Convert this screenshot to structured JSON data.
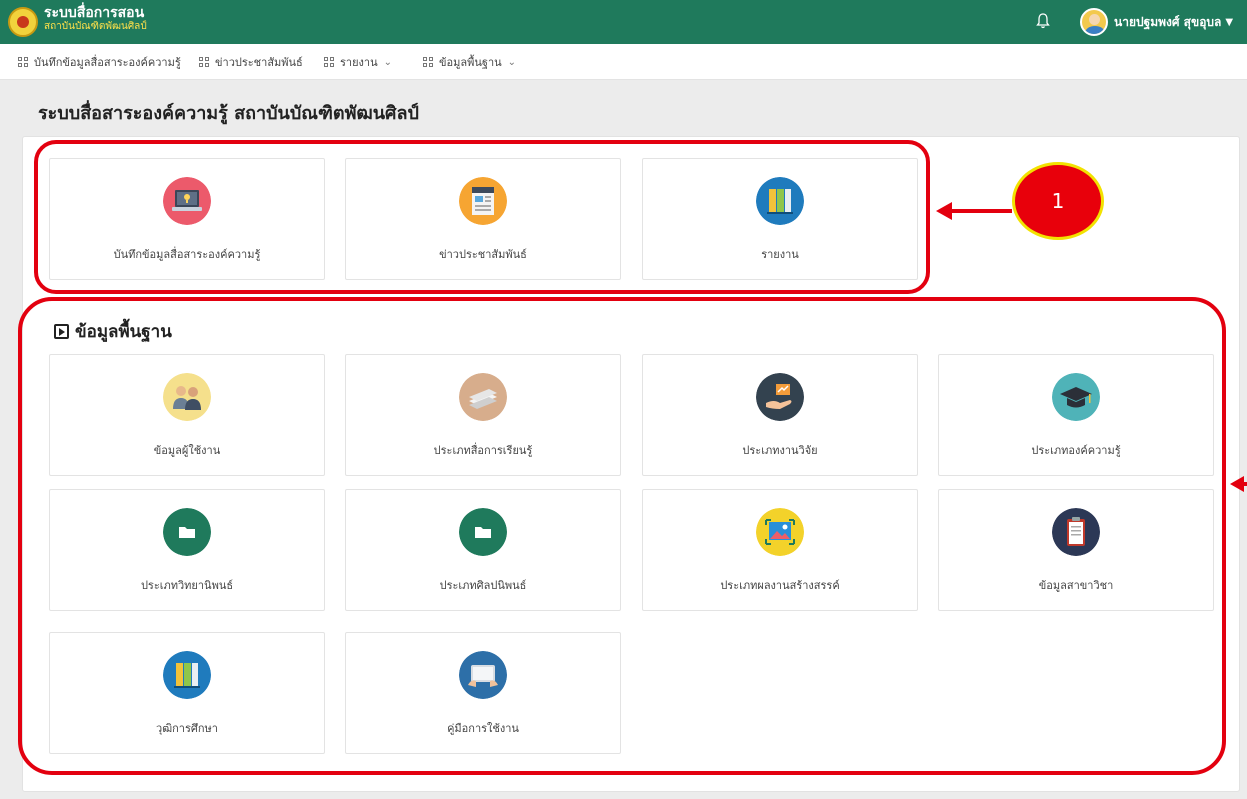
{
  "header": {
    "brand_title": "ระบบสื่อการสอน",
    "brand_subtitle": "สถาบันบัณฑิตพัฒนศิลป์",
    "user_name": "นายปฐมพงศ์ สุขอุบล",
    "bg_color": "#1f7a5c"
  },
  "menu": [
    {
      "label": "บันทึกข้อมูลสื่อสาระองค์ความรู้"
    },
    {
      "label": "ข่าวประชาสัมพันธ์"
    },
    {
      "label": "รายงาน"
    },
    {
      "label": "ข้อมูลพื้นฐาน"
    }
  ],
  "page_title": "ระบบสื่อสาระองค์ความรู้ สถาบันบัณฑิตพัฒนศิลป์",
  "main_cards": [
    {
      "label": "บันทึกข้อมูลสื่อสาระองค์ความรู้",
      "icon": "laptop-icon"
    },
    {
      "label": "ข่าวประชาสัมพันธ์",
      "icon": "news-icon"
    },
    {
      "label": "รายงาน",
      "icon": "binders-icon"
    }
  ],
  "section_title": "ข้อมูลพื้นฐาน",
  "base_cards": [
    {
      "label": "ข้อมูลผู้ใช้งาน",
      "icon": "users-icon"
    },
    {
      "label": "ประเภทสื่อการเรียนรู้",
      "icon": "papers-icon"
    },
    {
      "label": "ประเภทงานวิจัย",
      "icon": "research-icon"
    },
    {
      "label": "ประเภทองค์ความรู้",
      "icon": "graduation-cap-icon"
    },
    {
      "label": "ประเภทวิทยานิพนธ์",
      "icon": "folder-icon"
    },
    {
      "label": "ประเภทศิลปนิพนธ์",
      "icon": "folder-icon"
    },
    {
      "label": "ประเภทผลงานสร้างสรรค์",
      "icon": "image-icon"
    },
    {
      "label": "ข้อมูลสาขาวิชา",
      "icon": "clipboard-icon"
    },
    {
      "label": "วุฒิการศึกษา",
      "icon": "binders-icon"
    },
    {
      "label": "คู่มือการใช้งาน",
      "icon": "tablet-icon"
    }
  ],
  "annotation": {
    "number": "1",
    "color": "#e3000f"
  }
}
